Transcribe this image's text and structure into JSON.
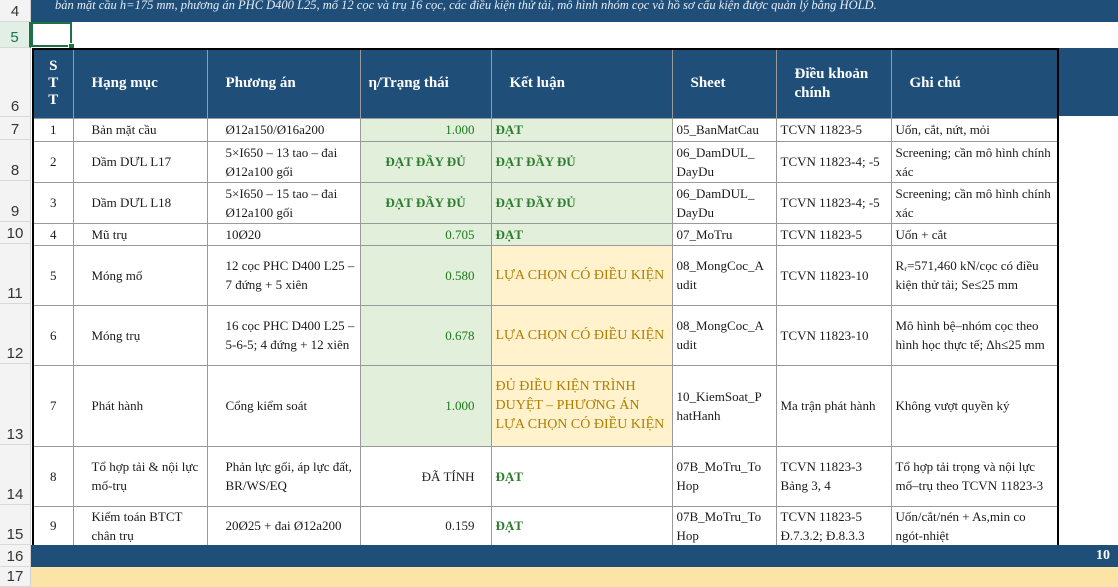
{
  "banner_text": "bản mặt cầu h=175 mm, phương án PHC D400 L25, mố 12 cọc và trụ 16 cọc, các điều kiện thử tải, mô hình nhóm cọc và hồ sơ cấu kiện được quản lý bằng HOLD.",
  "row_numbers": {
    "r4": "4",
    "r5": "5",
    "r6": "6",
    "r7": "7",
    "r8": "8",
    "r9": "9",
    "r10": "10",
    "r11": "11",
    "r12": "12",
    "r13": "13",
    "r14": "14",
    "r15": "15",
    "r16": "16",
    "r17": "17"
  },
  "headers": {
    "stt": "S\nT\nT",
    "hang_muc": "Hạng mục",
    "phuong_an": "Phương án",
    "eta": "η/Trạng thái",
    "ket_luan": "Kết luận",
    "sheet": "Sheet",
    "dieu_khoan": "Điều khoản chính",
    "ghi_chu": "Ghi chú"
  },
  "rows": [
    {
      "stt": "1",
      "hang_muc": "Bản mặt cầu",
      "phuong_an": "Ø12a150/Ø16a200",
      "eta": "1.000",
      "ket_luan": "ĐẠT",
      "sheet": "05_BanMatCau",
      "dieu_khoan": "TCVN 11823-5",
      "ghi_chu": "Uốn, cắt, nứt, mỏi"
    },
    {
      "stt": "2",
      "hang_muc": "Dầm DƯL L17",
      "phuong_an": "5×I650 – 13 tao – đai Ø12a100 gối",
      "eta": "ĐẠT ĐẦY ĐỦ",
      "ket_luan": "ĐẠT ĐẦY ĐỦ",
      "sheet": "06_DamDUL_ DayDu",
      "dieu_khoan": "TCVN 11823-4; -5",
      "ghi_chu": "Screening; cần mô hình chính xác"
    },
    {
      "stt": "3",
      "hang_muc": "Dầm DƯL L18",
      "phuong_an": "5×I650 – 15 tao – đai Ø12a100 gối",
      "eta": "ĐẠT ĐẦY ĐỦ",
      "ket_luan": "ĐẠT ĐẦY ĐỦ",
      "sheet": "06_DamDUL_ DayDu",
      "dieu_khoan": "TCVN 11823-4; -5",
      "ghi_chu": "Screening; cần mô hình chính xác"
    },
    {
      "stt": "4",
      "hang_muc": "Mũ trụ",
      "phuong_an": "10Ø20",
      "eta": "0.705",
      "ket_luan": "ĐẠT",
      "sheet": "07_MoTru",
      "dieu_khoan": "TCVN 11823-5",
      "ghi_chu": "Uốn + cắt"
    },
    {
      "stt": "5",
      "hang_muc": "Móng mố",
      "phuong_an": "12 cọc PHC D400 L25 – 7 đứng + 5 xiên",
      "eta": "0.580",
      "ket_luan": "LỰA CHỌN CÓ ĐIỀU KIỆN",
      "sheet": "08_MongCoc_A udit",
      "dieu_khoan": "TCVN 11823-10",
      "ghi_chu": "Rᵣ=571,460 kN/cọc có điều kiện thử tải; Se≤25 mm"
    },
    {
      "stt": "6",
      "hang_muc": "Móng trụ",
      "phuong_an": "16 cọc PHC D400 L25 – 5-6-5; 4 đứng + 12 xiên",
      "eta": "0.678",
      "ket_luan": "LỰA CHỌN CÓ ĐIỀU KIỆN",
      "sheet": "08_MongCoc_A udit",
      "dieu_khoan": "TCVN 11823-10",
      "ghi_chu": "Mô hình bệ–nhóm cọc theo hình học thực tế; Δh≤25 mm"
    },
    {
      "stt": "7",
      "hang_muc": "Phát hành",
      "phuong_an": "Cổng kiểm soát",
      "eta": "1.000",
      "ket_luan": "ĐỦ ĐIỀU KIỆN TRÌNH DUYỆT – PHƯƠNG ÁN LỰA CHỌN CÓ ĐIỀU KIỆN",
      "sheet": "10_KiemSoat_P hatHanh",
      "dieu_khoan": "Ma trận phát hành",
      "ghi_chu": "Không vượt quyền ký"
    },
    {
      "stt": "8",
      "hang_muc": "Tổ hợp tải & nội lực mố-trụ",
      "phuong_an": "Phản lực gối, áp lực đất, BR/WS/EQ",
      "eta": "ĐÃ TÍNH",
      "ket_luan": "ĐẠT",
      "sheet": "07B_MoTru_To Hop",
      "dieu_khoan": "TCVN 11823-3 Bảng 3, 4",
      "ghi_chu": "Tổ hợp tải trọng và nội lực mố–trụ theo TCVN 11823-3"
    },
    {
      "stt": "9",
      "hang_muc": "Kiểm toán BTCT chân trụ",
      "phuong_an": "20Ø25 + đai Ø12a200",
      "eta": "0.159",
      "ket_luan": "ĐẠT",
      "sheet": "07B_MoTru_To Hop",
      "dieu_khoan": "TCVN 11823-5 Đ.7.3.2; Đ.8.3.3",
      "ghi_chu": "Uốn/cắt/nén + As,min co ngót-nhiệt"
    }
  ],
  "footer_number": "10",
  "colors": {
    "header_blue": "#1f4e79",
    "pass_green": "#2e7d32",
    "green_fill": "#e2efda",
    "yellow_fill": "#fff2cc",
    "orange_text": "#b07d00",
    "footer_yellow": "#fce4a6"
  }
}
